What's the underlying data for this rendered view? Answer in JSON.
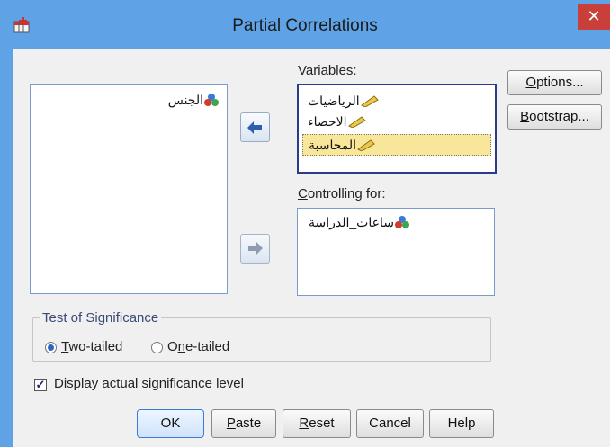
{
  "window": {
    "title": "Partial Correlations",
    "close_glyph": "✕",
    "app_icon": "spss-dialog-icon"
  },
  "source_list": {
    "items": [
      {
        "label": "الجنس",
        "icon": "nominal-measure-icon"
      }
    ]
  },
  "variables": {
    "label_prefix": "V",
    "label_rest": "ariables:",
    "items": [
      {
        "label": "الرياضيات",
        "icon": "scale-measure-icon",
        "selected": false
      },
      {
        "label": "الاحصاء",
        "icon": "scale-measure-icon",
        "selected": false
      },
      {
        "label": "المحاسبة",
        "icon": "scale-measure-icon",
        "selected": true
      }
    ]
  },
  "controlling": {
    "label_prefix": "C",
    "label_rest": "ontrolling for:",
    "items": [
      {
        "label": "ساعات_الدراسة",
        "icon": "nominal-measure-icon"
      }
    ]
  },
  "side_buttons": {
    "options_prefix": "O",
    "options_rest": "ptions...",
    "bootstrap_prefix": "B",
    "bootstrap_rest": "ootstrap..."
  },
  "significance": {
    "legend": "Test of Significance",
    "two_tailed_prefix": "T",
    "two_tailed_rest": "wo-tailed",
    "one_tailed_pre": "O",
    "one_tailed_ul": "n",
    "one_tailed_post": "e-tailed",
    "selected": "two-tailed"
  },
  "display_actual": {
    "prefix": "D",
    "rest": "isplay actual significance level",
    "checked": true
  },
  "bottom_buttons": {
    "ok": "OK",
    "paste_prefix": "P",
    "paste_rest": "aste",
    "reset_prefix": "R",
    "reset_rest": "eset",
    "cancel": "Cancel",
    "help": "Help"
  },
  "colors": {
    "title_bar": "#5fa3e6",
    "highlight": "#f8e79a",
    "close": "#c9403a"
  }
}
